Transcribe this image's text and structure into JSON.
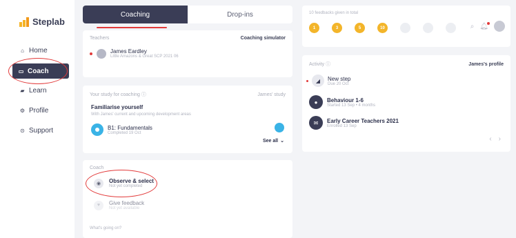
{
  "brand": {
    "name": "Steplab",
    "colors": {
      "accent": "#f3b52a",
      "primary": "#3a3d56",
      "annotation": "#e23a3a"
    }
  },
  "sidebar": {
    "items": [
      {
        "label": "Home",
        "icon": "home-icon"
      },
      {
        "label": "Coach",
        "icon": "chat-icon",
        "active": true
      },
      {
        "label": "Learn",
        "icon": "book-icon"
      },
      {
        "label": "Profile",
        "icon": "gear-icon"
      },
      {
        "label": "Support",
        "icon": "help-icon"
      }
    ]
  },
  "tabs": {
    "active": "Coaching",
    "other": "Drop-ins"
  },
  "teachers": {
    "title": "Teachers",
    "action": "Coaching simulator",
    "name": "James Eardley",
    "meta": "Little Amazons & Great SCP 2021 06"
  },
  "study": {
    "title": "Your study for coaching",
    "info": "ⓘ",
    "right_label": "James' study",
    "heading": "Familiarise yourself",
    "desc": "With James' current and upcoming development areas",
    "item_title": "B1: Fundamentals",
    "item_sub": "Completed 19 Oct",
    "see_all": "See all"
  },
  "coach_card": {
    "title": "Coach",
    "steps": [
      {
        "title": "Observe & select",
        "sub": "Not yet completed",
        "icon": "eye-icon"
      },
      {
        "title": "Give feedback",
        "sub": "Not yet available",
        "icon": "heart-icon"
      }
    ],
    "footer": "What's going on?"
  },
  "feedback": {
    "title": "10 feedbacks given in total",
    "badges": [
      "1",
      "3",
      "5",
      "10",
      "",
      "",
      ""
    ]
  },
  "activity": {
    "title": "Activity",
    "right_label": "James's profile",
    "items": [
      {
        "title": "New step",
        "sub": "Due 20 Oct",
        "icon": "step-icon"
      },
      {
        "title": "Behaviour 1-6",
        "sub": "Started 13 Sep • 4 months",
        "icon": "behaviour-icon"
      },
      {
        "title": "Early Career Teachers 2021",
        "sub": "Enrolled 13 Sep",
        "icon": "course-icon"
      }
    ]
  }
}
